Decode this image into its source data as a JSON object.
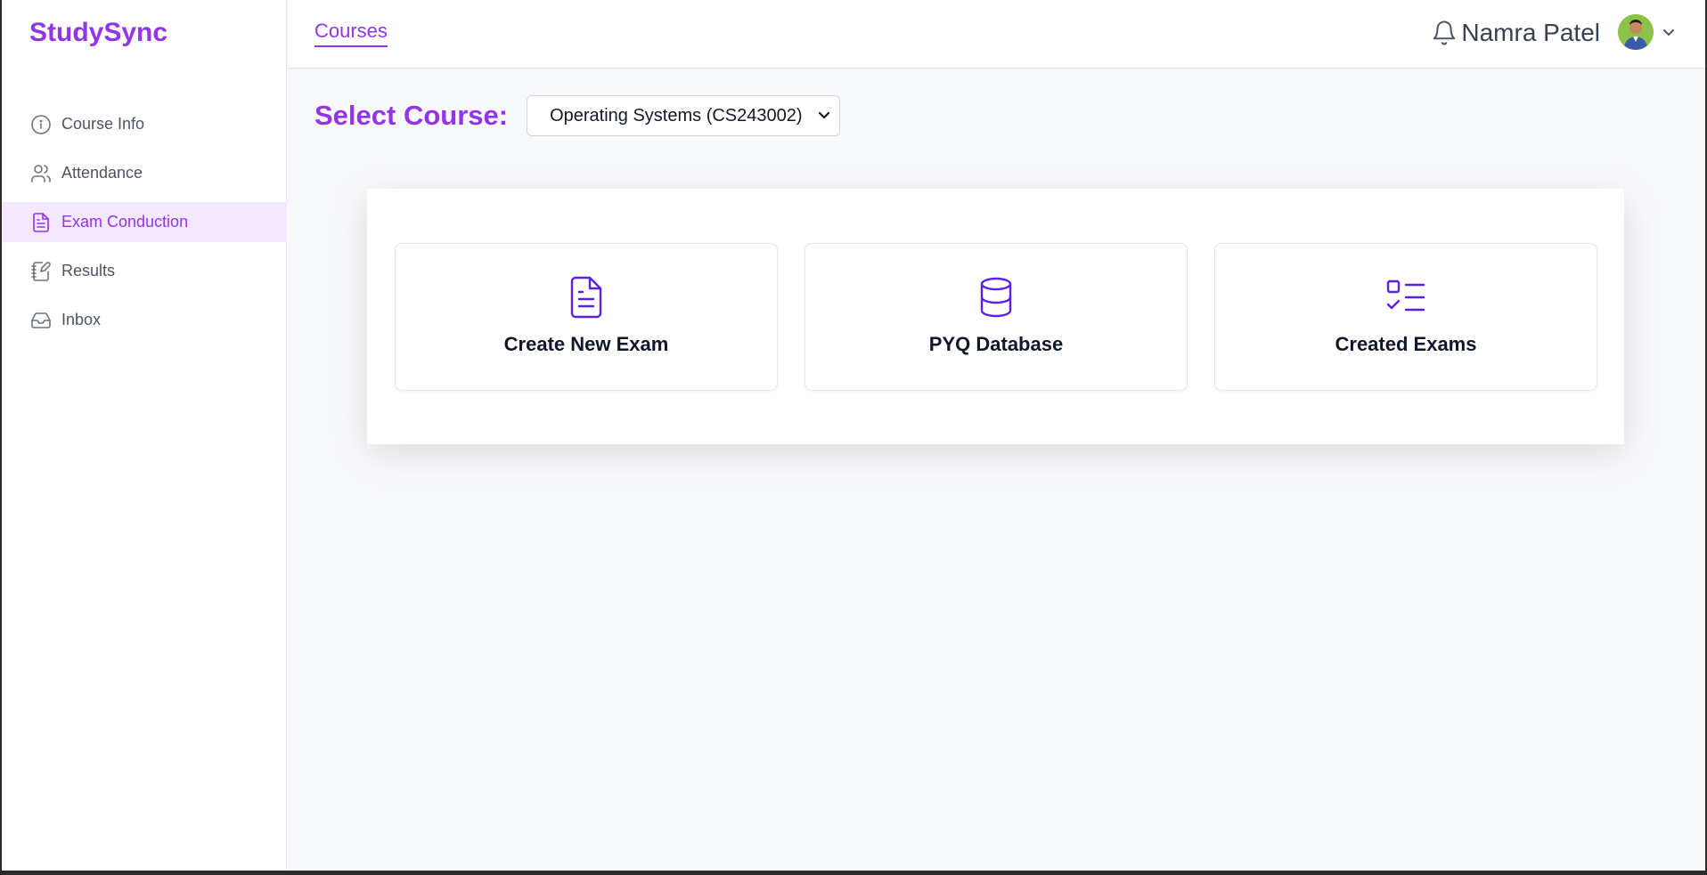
{
  "app": {
    "brand": "StudySync"
  },
  "sidebar": {
    "items": [
      {
        "label": "Course Info",
        "icon": "info-icon",
        "active": false
      },
      {
        "label": "Attendance",
        "icon": "users-icon",
        "active": false
      },
      {
        "label": "Exam Conduction",
        "icon": "document-icon",
        "active": true
      },
      {
        "label": "Results",
        "icon": "notebook-pen-icon",
        "active": false
      },
      {
        "label": "Inbox",
        "icon": "inbox-icon",
        "active": false
      }
    ]
  },
  "header": {
    "tab": "Courses",
    "user_name": "Namra Patel",
    "notification_icon": "bell-icon",
    "avatar_icon": "avatar",
    "menu_icon": "chevron-down-icon"
  },
  "course_select": {
    "label": "Select Course:",
    "selected": "Operating Systems (CS243002)"
  },
  "cards": [
    {
      "title": "Create New Exam",
      "icon": "file-text-icon"
    },
    {
      "title": "PYQ Database",
      "icon": "database-icon"
    },
    {
      "title": "Created Exams",
      "icon": "list-checks-icon"
    }
  ],
  "colors": {
    "accent": "#9333ea",
    "active_bg": "#f3e8ff",
    "card_icon": "#5b21e6",
    "page_bg": "#f8f9fb"
  }
}
